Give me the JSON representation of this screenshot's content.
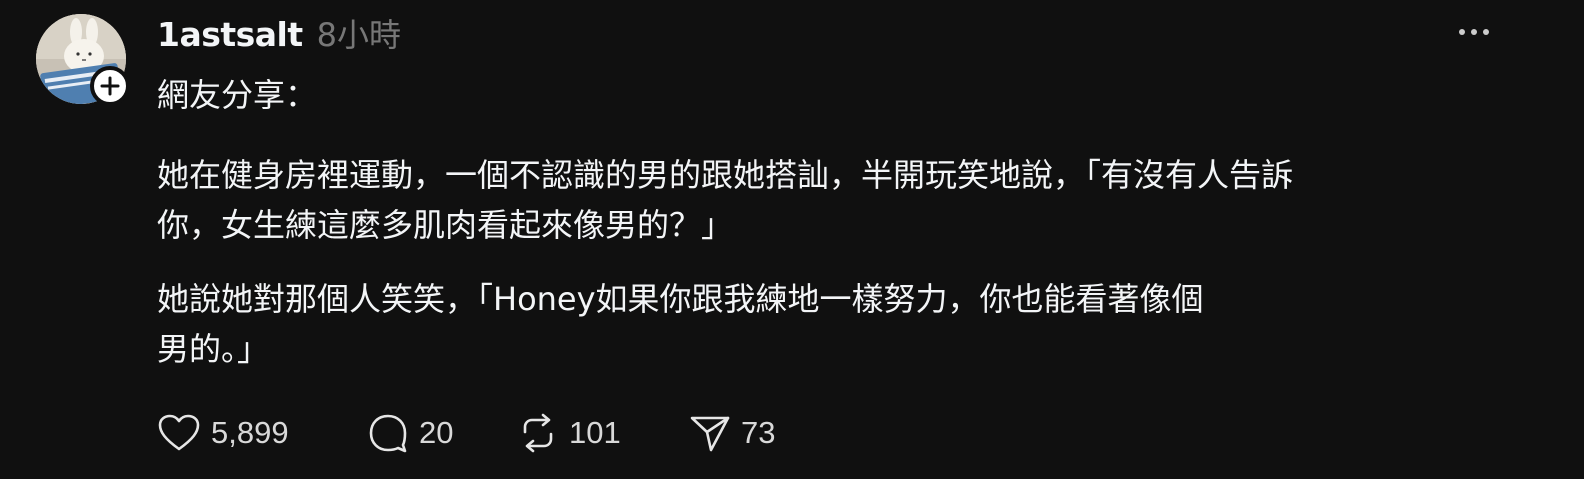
{
  "post": {
    "username": "1astsalt",
    "timestamp": "8小時",
    "paragraphs": {
      "p1": "網友分享：",
      "p2_line1": "她在健身房裡運動，一個不認識的男的跟她搭訕，半開玩笑地說，「有沒有人告訴",
      "p2_line2": "你，女生練這麼多肌肉看起來像男的？」",
      "p3_line1": "她說她對那個人笑笑，「Honey如果你跟我練地一樣努力，你也能看著像個",
      "p3_line2": "男的。」"
    },
    "actions": {
      "likes": "5,899",
      "replies": "20",
      "reposts": "101",
      "shares": "73"
    }
  },
  "icons": {
    "avatar": "avatar-image",
    "follow": "plus-icon",
    "more": "more-dots-icon",
    "like": "heart-icon",
    "reply": "speech-bubble-icon",
    "repost": "repost-arrows-icon",
    "share": "send-icon"
  },
  "colors": {
    "background": "#101010",
    "text": "#f3f5f7",
    "muted": "#777777"
  }
}
